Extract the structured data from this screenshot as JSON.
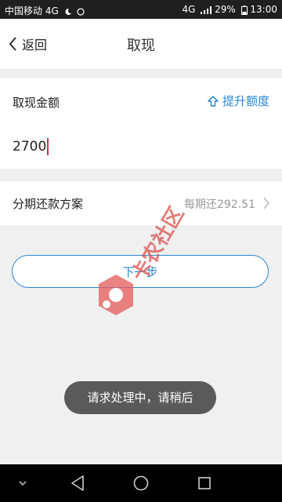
{
  "status_bar": {
    "carrier": "中国移动 4G",
    "network": "4G",
    "battery": "29%",
    "time": "13:00"
  },
  "header": {
    "back_label": "返回",
    "title": "取现"
  },
  "amount": {
    "label": "取现金额",
    "raise_limit_label": "提升额度",
    "value": "2700"
  },
  "plan": {
    "label": "分期还款方案",
    "value": "每期还292.51"
  },
  "next_button": {
    "label": "下一步"
  },
  "watermark": {
    "text": "卡农社区"
  },
  "toast": {
    "message": "请求处理中，请稍后"
  },
  "nav": {
    "icons": [
      "chevron-down-icon",
      "back-triangle-icon",
      "home-circle-icon",
      "recent-square-icon"
    ]
  },
  "colors": {
    "accent": "#2a87d8",
    "caret": "#e0294a",
    "watermark": "#d9534f"
  }
}
